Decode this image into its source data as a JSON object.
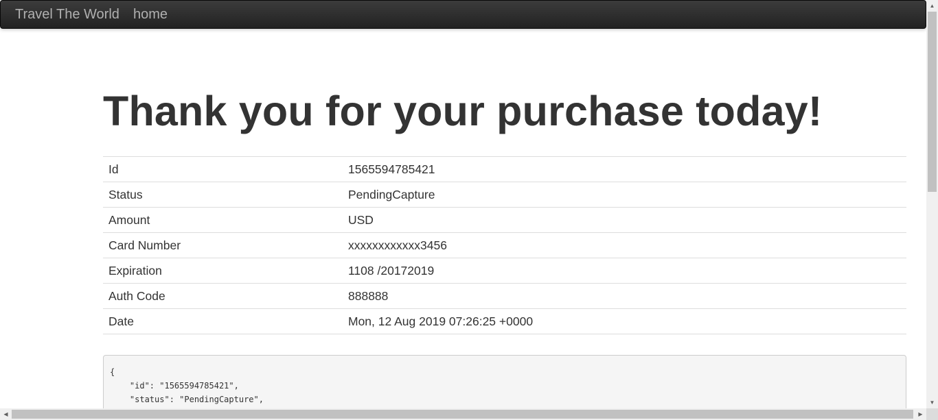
{
  "navbar": {
    "brand": "Travel The World",
    "home_link": "home"
  },
  "main": {
    "heading": "Thank you for your purchase today!",
    "details": [
      {
        "label": "Id",
        "value": "1565594785421"
      },
      {
        "label": "Status",
        "value": "PendingCapture"
      },
      {
        "label": "Amount",
        "value": "USD"
      },
      {
        "label": "Card Number",
        "value": "xxxxxxxxxxxx3456"
      },
      {
        "label": "Expiration",
        "value": "1108 /20172019"
      },
      {
        "label": "Auth Code",
        "value": "888888"
      },
      {
        "label": "Date",
        "value": "Mon, 12 Aug 2019 07:26:25 +0000"
      }
    ],
    "json_dump": "{\n    \"id\": \"1565594785421\",\n    \"status\": \"PendingCapture\",\n    \"amount\": \"\","
  },
  "scrollbars": {
    "up_arrow_icon": "triangle-up",
    "down_arrow_icon": "triangle-down",
    "left_arrow_icon": "triangle-left",
    "right_arrow_icon": "triangle-right"
  }
}
